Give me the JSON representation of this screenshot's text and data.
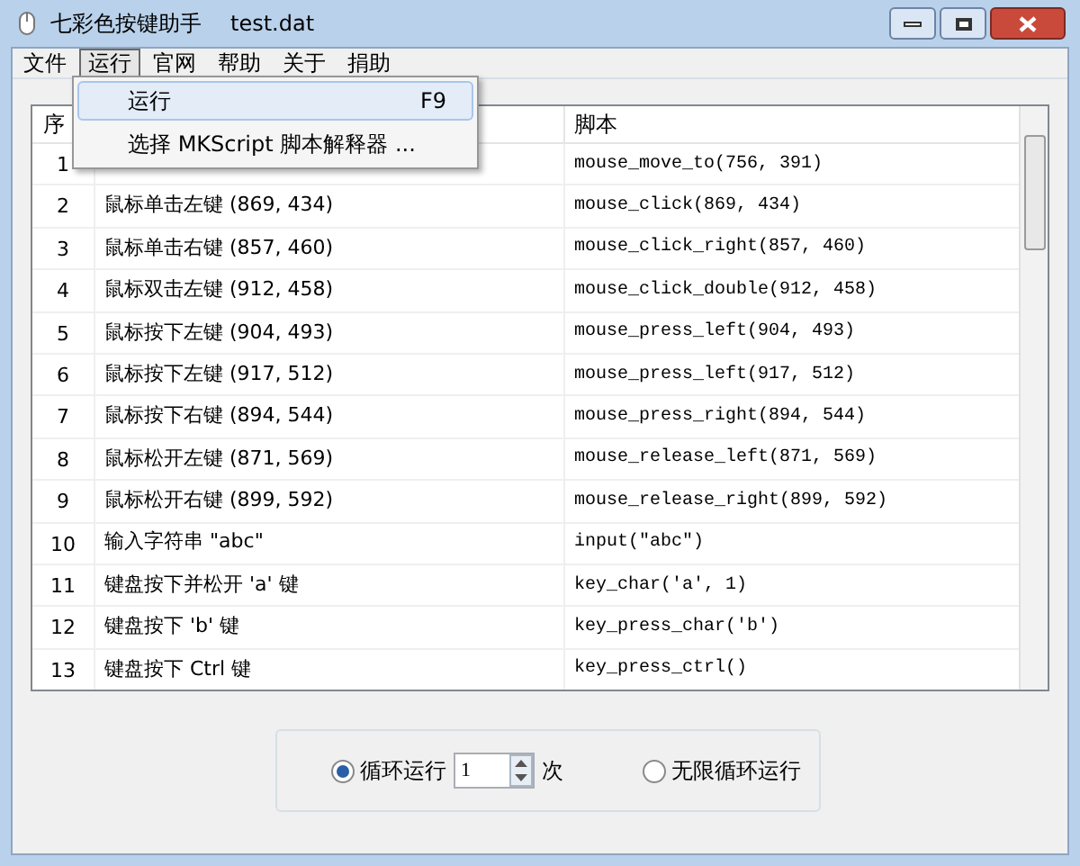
{
  "window": {
    "title": "七彩色按键助手",
    "file": "test.dat"
  },
  "menu_bar": [
    {
      "label": "文件",
      "selected": false
    },
    {
      "label": "运行",
      "selected": true
    },
    {
      "label": "官网",
      "selected": false
    },
    {
      "label": "帮助",
      "selected": false
    },
    {
      "label": "关于",
      "selected": false
    },
    {
      "label": "捐助",
      "selected": false
    }
  ],
  "dropdown": [
    {
      "label": "运行",
      "shortcut": "F9",
      "selected": true
    },
    {
      "label": "选择 MKScript 脚本解释器 ...",
      "selected": false
    }
  ],
  "table": {
    "columns": [
      "序",
      "脚本"
    ],
    "rows": [
      {
        "index": "1",
        "script": "mouse_move_to(756, 391)"
      },
      {
        "index": "2",
        "description": "鼠标单击左键 (869, 434)",
        "script": "mouse_click(869, 434)"
      },
      {
        "index": "3",
        "description": "鼠标单击右键 (857, 460)",
        "script": "mouse_click_right(857, 460)"
      },
      {
        "index": "4",
        "description": "鼠标双击左键 (912, 458)",
        "script": "mouse_click_double(912, 458)"
      },
      {
        "index": "5",
        "description": "鼠标按下左键 (904, 493)",
        "script": "mouse_press_left(904, 493)"
      },
      {
        "index": "6",
        "description": "鼠标按下左键 (917, 512)",
        "script": "mouse_press_left(917, 512)"
      },
      {
        "index": "7",
        "description": "鼠标按下右键 (894, 544)",
        "script": "mouse_press_right(894, 544)"
      },
      {
        "index": "8",
        "description": "鼠标松开左键 (871, 569)",
        "script": "mouse_release_left(871, 569)"
      },
      {
        "index": "9",
        "description": "鼠标松开右键 (899, 592)",
        "script": "mouse_release_right(899, 592)"
      },
      {
        "index": "10",
        "description": "输入字符串 \"abc\"",
        "script": "input(\"abc\")"
      },
      {
        "index": "11",
        "description": "键盘按下并松开 'a' 键",
        "script": "key_char('a', 1)"
      },
      {
        "index": "12",
        "description": "键盘按下 'b' 键",
        "script": "key_press_char('b')"
      },
      {
        "index": "13",
        "description": "键盘按下 Ctrl 键",
        "script": "key_press_ctrl()"
      }
    ]
  },
  "loop": {
    "options": [
      {
        "label": "循环运行",
        "selected": true
      },
      {
        "label": "无限循环运行",
        "selected": false
      }
    ],
    "count": "1",
    "unit": "次"
  }
}
